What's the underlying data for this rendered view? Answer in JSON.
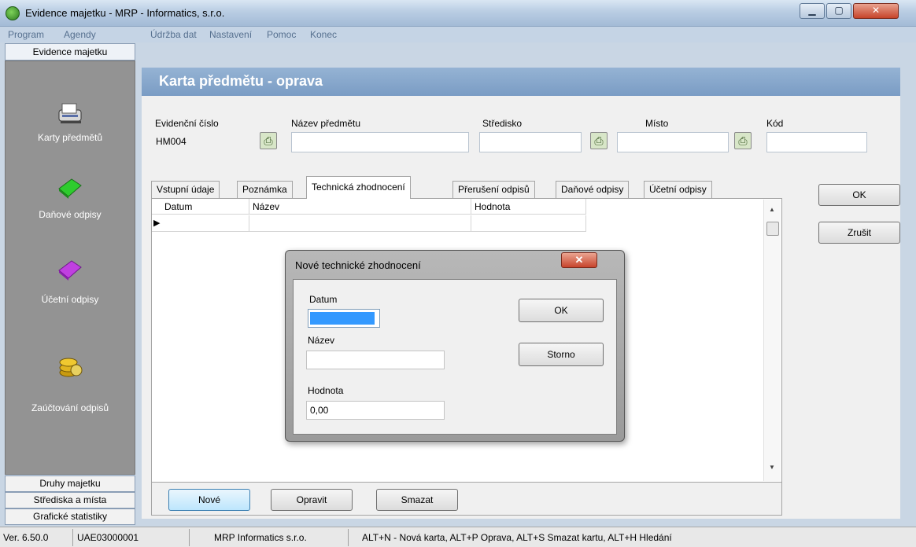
{
  "window": {
    "title": "Evidence majetku - MRP - Informatics, s.r.o.",
    "minimize": "▁",
    "maximize": "▢",
    "close": "✕"
  },
  "menu": [
    "Program",
    "Agendy",
    "Údržba dat",
    "Nastavení",
    "Pomoc",
    "Konec"
  ],
  "nav": {
    "header": "Evidence majetku",
    "items": [
      {
        "label": "Karty předmětů",
        "icon": "scanner-icon"
      },
      {
        "label": "Daňové odpisy",
        "icon": "green-book-icon"
      },
      {
        "label": "Účetní odpisy",
        "icon": "purple-book-icon"
      },
      {
        "label": "Zaúčtování odpisů",
        "icon": "coins-icon"
      }
    ],
    "bottom": [
      "Druhy majetku",
      "Střediska a místa",
      "Grafické statistiky"
    ]
  },
  "form": {
    "title": "Karta předmětu - oprava",
    "fields": {
      "evidencni_cislo": {
        "label": "Evidenční číslo",
        "value": "HM004"
      },
      "nazev_predmetu": {
        "label": "Název předmětu",
        "value": ""
      },
      "stredisko": {
        "label": "Středisko",
        "value": ""
      },
      "misto": {
        "label": "Místo",
        "value": ""
      },
      "kod": {
        "label": "Kód",
        "value": ""
      }
    },
    "tabs": [
      "Vstupní údaje",
      "Poznámka",
      "Technická zhodnocení",
      "Přerušení odpisů",
      "Daňové odpisy",
      "Účetní odpisy"
    ],
    "active_tab": "Technická zhodnocení",
    "grid_columns": [
      "Datum",
      "Název",
      "Hodnota"
    ],
    "row_marker": "▶",
    "ok": "OK",
    "cancel": "Zrušit",
    "buttons": {
      "new": "Nové",
      "edit": "Opravit",
      "delete": "Smazat"
    }
  },
  "dialog": {
    "title": "Nové technické zhodnocení",
    "close": "✕",
    "datum_label": "Datum",
    "datum_value": "",
    "nazev_label": "Název",
    "nazev_value": "",
    "hodnota_label": "Hodnota",
    "hodnota_value": "0,00",
    "ok": "OK",
    "storno": "Storno"
  },
  "status": {
    "version": "Ver. 6.50.0",
    "code": "UAE03000001",
    "company": "MRP Informatics s.r.o.",
    "shortcuts": "ALT+N - Nová karta, ALT+P Oprava, ALT+S Smazat kartu, ALT+H Hledání"
  }
}
